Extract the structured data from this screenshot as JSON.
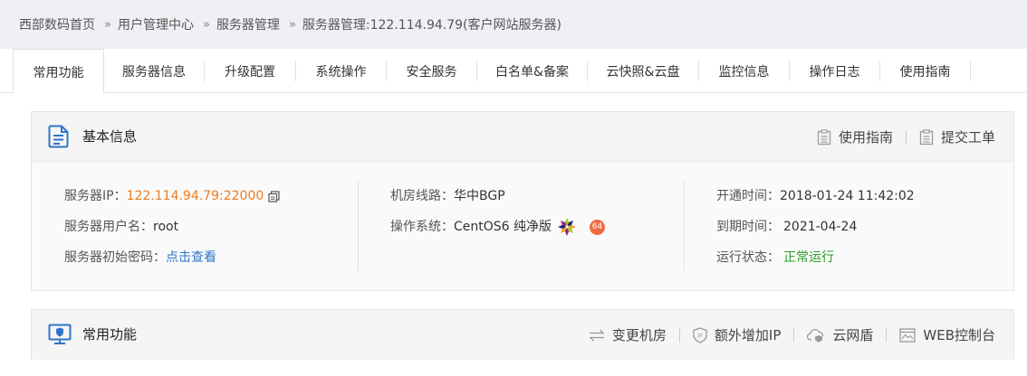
{
  "breadcrumb": {
    "items": [
      "西部数码首页",
      "用户管理中心",
      "服务器管理",
      "服务器管理:122.114.94.79(客户网站服务器)"
    ],
    "separator": "»"
  },
  "tabs": [
    {
      "label": "常用功能",
      "active": true
    },
    {
      "label": "服务器信息"
    },
    {
      "label": "升级配置"
    },
    {
      "label": "系统操作"
    },
    {
      "label": "安全服务"
    },
    {
      "label": "白名单&备案"
    },
    {
      "label": "云快照&云盘"
    },
    {
      "label": "监控信息"
    },
    {
      "label": "操作日志"
    },
    {
      "label": "使用指南"
    }
  ],
  "basic_info": {
    "title": "基本信息",
    "links": [
      "使用指南",
      "提交工单"
    ],
    "server_ip_label": "服务器IP：",
    "server_ip": "122.114.94.79:22000",
    "username_label": "服务器用户名：",
    "username": "root",
    "password_label": "服务器初始密码：",
    "password_link": "点击查看",
    "line_label": "机房线路：",
    "line": "华中BGP",
    "os_label": "操作系统：",
    "os": "CentOS6 纯净版",
    "os_bits": "64",
    "open_label": "开通时间：",
    "open_time": "2018-01-24 11:42:02",
    "expire_label": "到期时间：",
    "expire_time": "2021-04-24",
    "status_label": "运行状态：",
    "status": "正常运行"
  },
  "common_functions": {
    "title": "常用功能",
    "actions": [
      "变更机房",
      "额外增加IP",
      "云网盾",
      "WEB控制台"
    ]
  },
  "colors": {
    "accent": "#2f73c9",
    "orange": "#ee7b1f",
    "green": "#2a9d2a",
    "badge": "#f16a42"
  }
}
